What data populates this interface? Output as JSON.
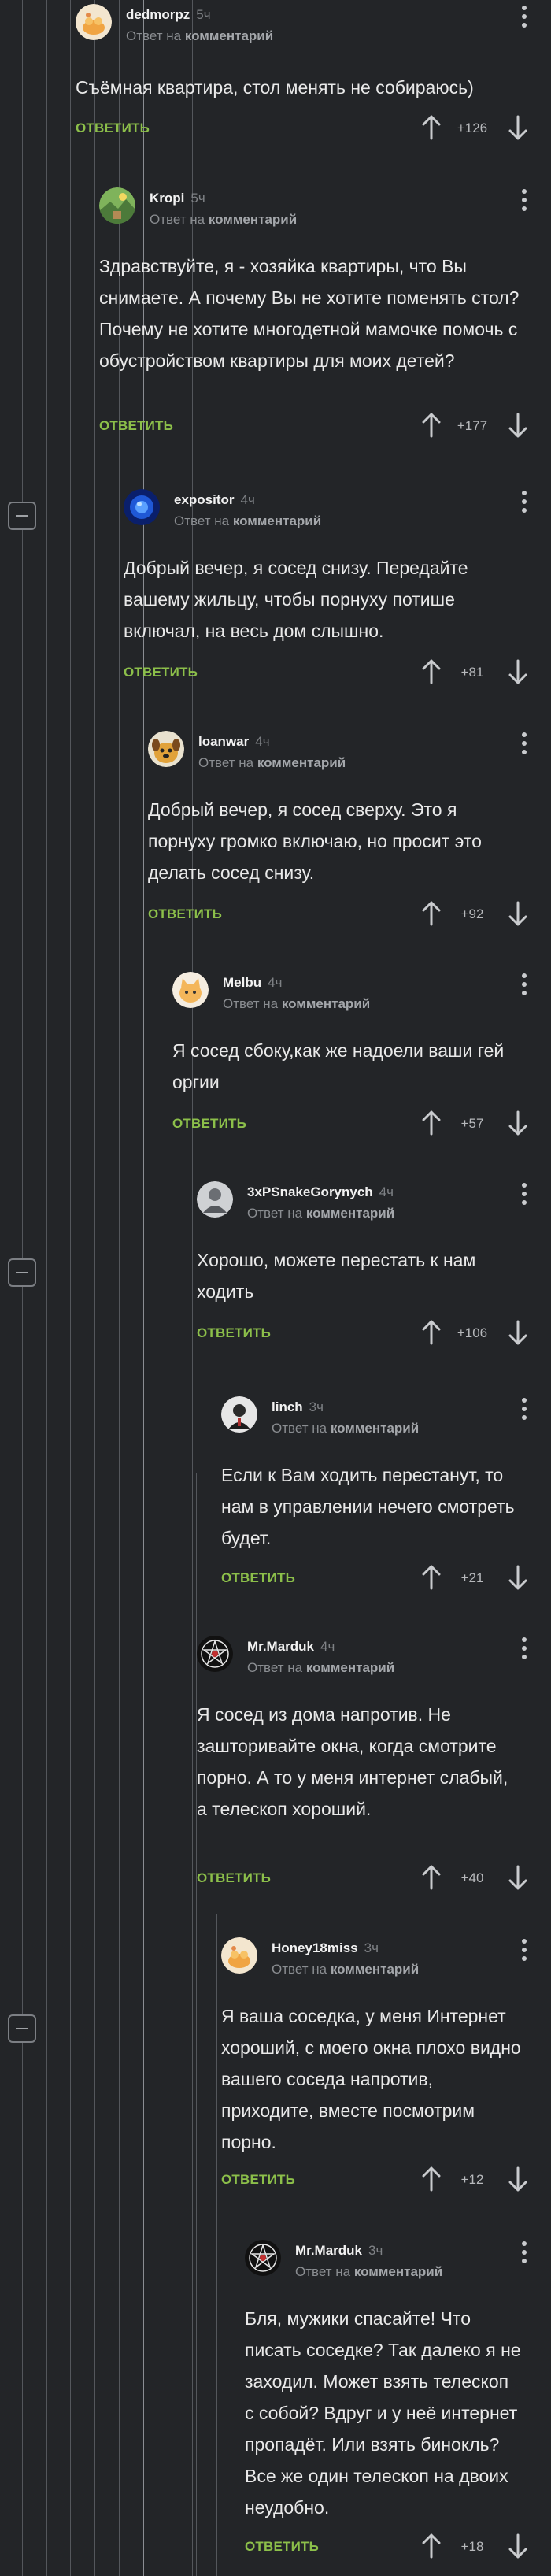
{
  "reply_to_prefix": "Ответ на",
  "reply_to_link": "комментарий",
  "reply_label": "ОТВЕТИТЬ",
  "colors": {
    "background": "#232528",
    "reply": "#8cbf4a",
    "text": "#e9e9e9"
  },
  "comments": [
    {
      "author": "dedmorpz",
      "time": "5ч",
      "avatar": "cat-cake-avatar",
      "text": "Съёмная квартира, стол менять не собираюсь)",
      "score": "+126"
    },
    {
      "author": "Kropi",
      "time": "5ч",
      "avatar": "landscape-avatar",
      "text": "Здравствуйте, я - хозяйка квартиры, что Вы снимаете. А почему Вы не хотите поменять стол? Почему не хотите многодетной мамочке помочь с обустройством квартиры для моих детей?",
      "score": "+177"
    },
    {
      "author": "expositor",
      "time": "4ч",
      "avatar": "blue-orb-avatar",
      "text": "Добрый вечер, я сосед снизу. Передайте вашему жильцу, чтобы порнуху потише включал, на весь дом слышно.",
      "score": "+81"
    },
    {
      "author": "loanwar",
      "time": "4ч",
      "avatar": "cartoon-dog-avatar",
      "text": "Добрый вечер, я сосед сверху. Это я порнуху громко включаю, но просит это делать сосед снизу.",
      "score": "+92"
    },
    {
      "author": "Melbu",
      "time": "4ч",
      "avatar": "cat-face-avatar",
      "text": "Я сосед сбоку,как же надоели ваши гей оргии",
      "score": "+57"
    },
    {
      "author": "3xPSnakeGorynych",
      "time": "4ч",
      "avatar": "grey-figure-avatar",
      "text": "Хорошо, можете перестать к нам ходить",
      "score": "+106"
    },
    {
      "author": "linch",
      "time": "3ч",
      "avatar": "dark-person-avatar",
      "text": "Если к Вам ходить перестанут, то нам в управлении нечего смотреть будет.",
      "score": "+21"
    },
    {
      "author": "Mr.Marduk",
      "time": "4ч",
      "avatar": "pentagram-avatar",
      "text": "Я сосед из дома напротив. Не зашторивайте окна, когда смотрите порно. А то у меня интернет слабый, а телескоп хороший.",
      "score": "+40"
    },
    {
      "author": "Honey18miss",
      "time": "3ч",
      "avatar": "cat-cake-avatar",
      "text": "Я ваша соседка, у меня Интернет хороший, с моего окна плохо видно вашего соседа напротив, приходите, вместе посмотрим порно.",
      "score": "+12"
    },
    {
      "author": "Mr.Marduk",
      "time": "3ч",
      "avatar": "pentagram-avatar",
      "text": "Бля, мужики спасайте! Что писать соседке? Так далеко я не заходил. Может взять телескоп с собой? Вдруг и у неё интернет пропадёт. Или взять бинокль? Все же один телескоп на двоих неудобно.",
      "score": "+18"
    }
  ]
}
